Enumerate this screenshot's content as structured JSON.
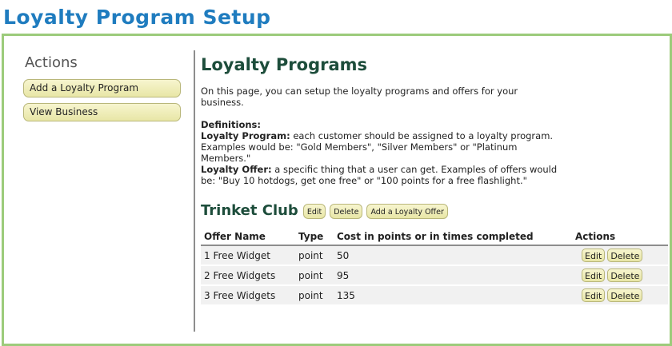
{
  "page": {
    "title": "Loyalty Program Setup"
  },
  "sidebar": {
    "heading": "Actions",
    "buttons": [
      {
        "label": "Add a Loyalty Program"
      },
      {
        "label": "View Business"
      }
    ]
  },
  "main": {
    "heading": "Loyalty Programs",
    "intro": "On this page, you can setup the loyalty programs and offers for your business.",
    "definitions": {
      "heading": "Definitions:",
      "program_term": "Loyalty Program:",
      "program_text": " each customer should be assigned to a loyalty program. Examples would be: \"Gold Members\", \"Silver Members\" or \"Platinum Members.\"",
      "offer_term": "Loyalty Offer:",
      "offer_text": " a specific thing that a user can get. Examples of offers would be: \"Buy 10 hotdogs, get one free\" or \"100 points for a free flashlight.\""
    },
    "program": {
      "name": "Trinket Club",
      "edit_label": "Edit",
      "delete_label": "Delete",
      "add_offer_label": "Add a Loyalty Offer"
    },
    "table": {
      "headers": {
        "name": "Offer Name",
        "type": "Type",
        "cost": "Cost in points or in times completed",
        "actions": "Actions"
      },
      "rows": [
        {
          "name": "1 Free Widget",
          "type": "point",
          "cost": "50",
          "edit": "Edit",
          "delete": "Delete"
        },
        {
          "name": "2 Free Widgets",
          "type": "point",
          "cost": "95",
          "edit": "Edit",
          "delete": "Delete"
        },
        {
          "name": "3 Free Widgets",
          "type": "point",
          "cost": "135",
          "edit": "Edit",
          "delete": "Delete"
        }
      ]
    }
  },
  "colors": {
    "title_blue": "#1f7cbf",
    "frame_green": "#9ccb7b",
    "heading_green": "#1d4d3b",
    "button_fill": "#efedbc"
  }
}
